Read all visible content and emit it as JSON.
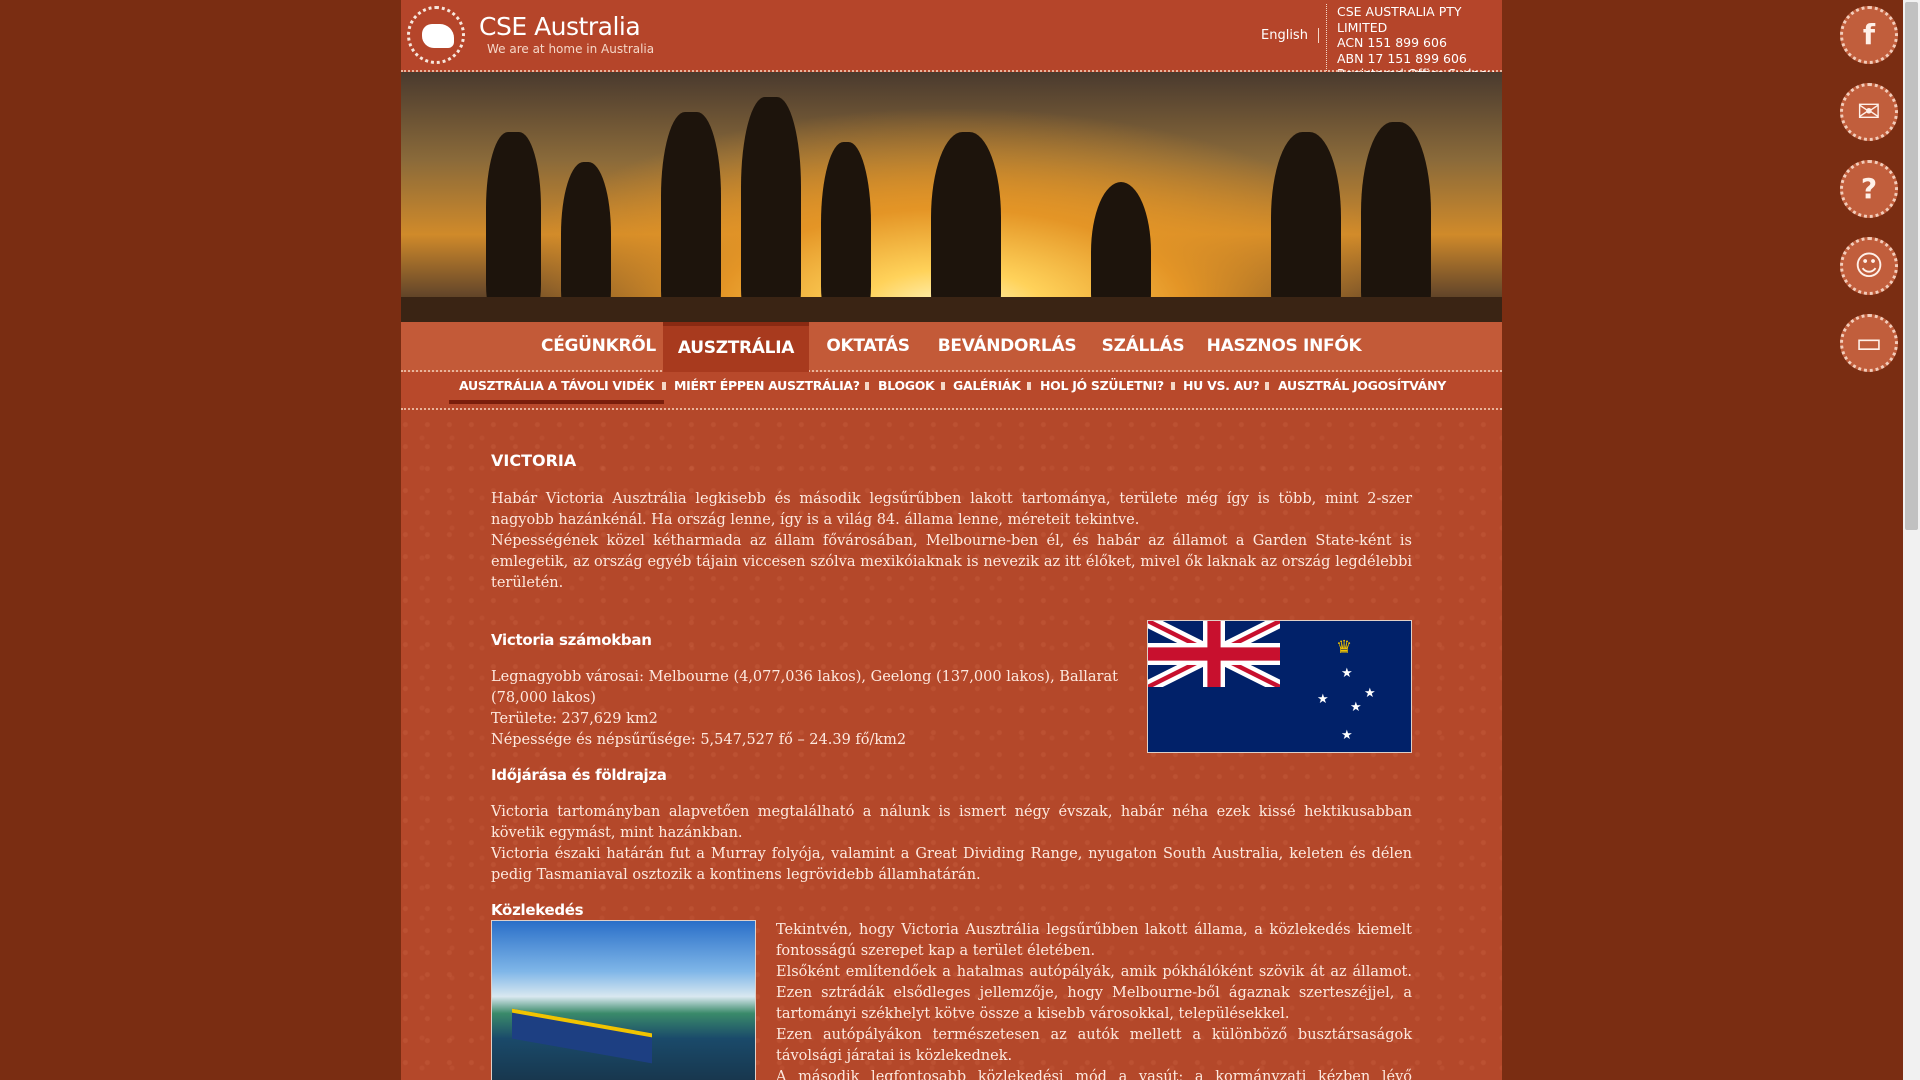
{
  "header": {
    "logo_title": "CSE Australia",
    "logo_subtitle": "We are at home in Australia",
    "language": "English",
    "company": {
      "name": "CSE AUSTRALIA PTY LIMITED",
      "acn": "ACN 151 899 606",
      "abn": "ABN 17 151 899 606",
      "office": "Registered Office Sydney NSW"
    }
  },
  "main_nav": [
    "CÉGÜNKRŐL",
    "AUSZTRÁLIA",
    "OKTATÁS",
    "BEVÁNDORLÁS",
    "SZÁLLÁS",
    "HASZNOS INFÓK"
  ],
  "main_nav_active": "AUSZTRÁLIA",
  "sub_nav": [
    "AUSZTRÁLIA A TÁVOLI VIDÉK",
    "MIÉRT ÉPPEN AUSZTRÁLIA?",
    "BLOGOK",
    "GALÉRIÁK",
    "HOL JÓ SZÜLETNI?",
    "HU VS. AU?",
    "AUSZTRÁL JOGOSÍTVÁNY"
  ],
  "sub_nav_active": "AUSZTRÁLIA A TÁVOLI VIDÉK",
  "content": {
    "title": "VICTORIA",
    "intro_1": "Habár Victoria Ausztrália legkisebb és második legsűrűbben lakott tartománya, területe még így is több, mint 2-szer nagyobb hazánkénál. Ha ország lenne, így is a világ 84. állama lenne, méreteit tekintve.",
    "intro_2": "Népességének közel kétharmada az állam fővárosában, Melbourne-ben él, és habár az államot a Garden State-ként is emlegetik, az ország egyéb tájain viccesen szólva mexikóiaknak is nevezik az itt élőket, mivel ők laknak az ország legdélebbi területén.",
    "numbers_heading": "Victoria számokban",
    "numbers_1": "Legnagyobb városai: Melbourne (4,077,036 lakos), Geelong (137,000 lakos), Ballarat (78,000 lakos)",
    "numbers_2": "Területe: 237,629 km2",
    "numbers_3": "Népessége és népsűrűsége: 5,547,527 fő – 24.39 fő/km2",
    "weather_heading": "Időjárása és földrajza",
    "weather_1": "Victoria tartományban alapvetően megtalálható a nálunk is ismert négy évszak, habár néha ezek kissé hektikusabban követik egymást, mint hazánkban.",
    "weather_2": "Victoria északi határán fut a Murray folyója, valamint a Great Dividing Range, nyugaton South Australia, keleten és délen pedig Tasmaniaval osztozik a kontinens legrövidebb államhatárán.",
    "transport_heading": "Közlekedés",
    "transport_1": "Tekintvén, hogy Victoria Ausztrália legsűrűbben lakott állama, a közlekedés kiemelt fontosságú szerepet kap a terület életében.",
    "transport_2": "Elsőként említendőek a hatalmas autópályák, amik pókhálóként szövik át az államot. Ezen sztrádák elsődleges jellemzője, hogy Melbourne-ből ágaznak szerteszéjjel, a tartományi székhelyt kötve össze a kisebb városokkal, településekkel.",
    "transport_3": "Ezen autópályákon természetesen az autók mellett a különböző busztársaságok távolsági járatai is közlekednek.",
    "transport_4": "A második legfontosabb közlekedési mód a vasút; a kormányzati kézben lévő sínpályákon számos"
  },
  "social": [
    "facebook-icon",
    "mail-icon",
    "help-icon",
    "community-icon",
    "screen-icon"
  ],
  "colors": {
    "page_bg": "#7a2d12",
    "panel_bg": "#b4482a",
    "nav_active": "#a83a1e"
  }
}
